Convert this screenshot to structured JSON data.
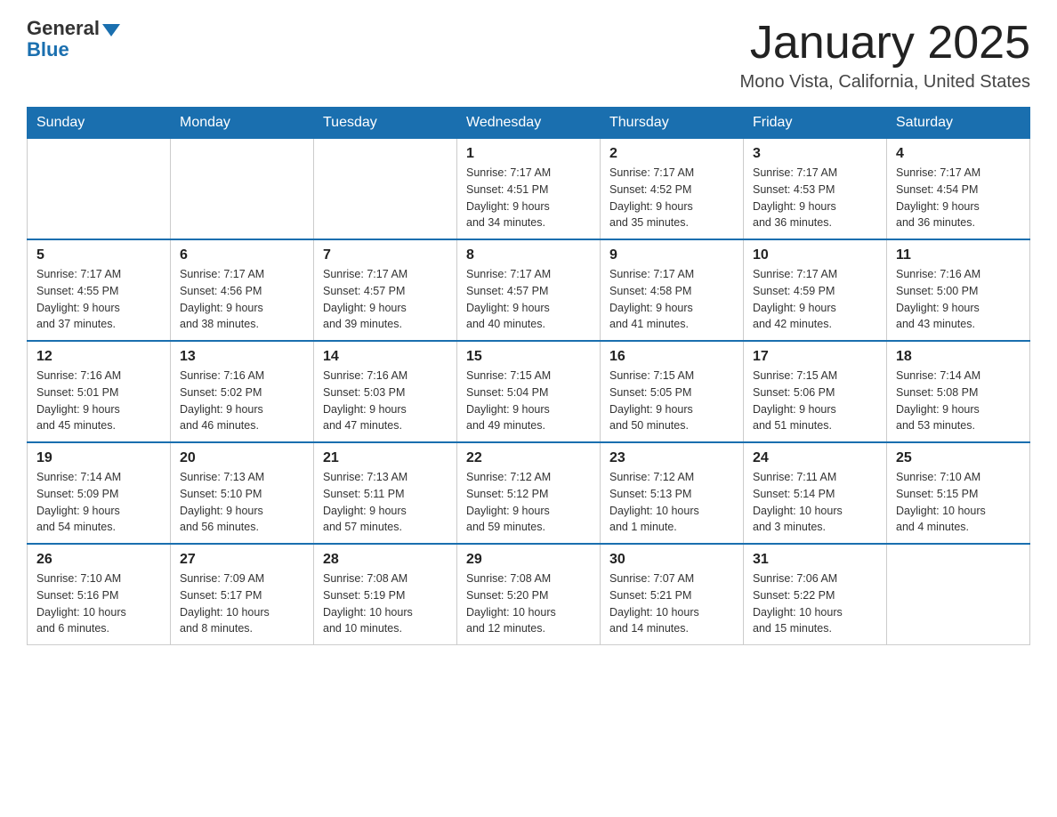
{
  "header": {
    "logo_line1": "General",
    "logo_line2": "Blue",
    "title": "January 2025",
    "subtitle": "Mono Vista, California, United States"
  },
  "weekdays": [
    "Sunday",
    "Monday",
    "Tuesday",
    "Wednesday",
    "Thursday",
    "Friday",
    "Saturday"
  ],
  "weeks": [
    [
      {
        "day": "",
        "info": ""
      },
      {
        "day": "",
        "info": ""
      },
      {
        "day": "",
        "info": ""
      },
      {
        "day": "1",
        "info": "Sunrise: 7:17 AM\nSunset: 4:51 PM\nDaylight: 9 hours\nand 34 minutes."
      },
      {
        "day": "2",
        "info": "Sunrise: 7:17 AM\nSunset: 4:52 PM\nDaylight: 9 hours\nand 35 minutes."
      },
      {
        "day": "3",
        "info": "Sunrise: 7:17 AM\nSunset: 4:53 PM\nDaylight: 9 hours\nand 36 minutes."
      },
      {
        "day": "4",
        "info": "Sunrise: 7:17 AM\nSunset: 4:54 PM\nDaylight: 9 hours\nand 36 minutes."
      }
    ],
    [
      {
        "day": "5",
        "info": "Sunrise: 7:17 AM\nSunset: 4:55 PM\nDaylight: 9 hours\nand 37 minutes."
      },
      {
        "day": "6",
        "info": "Sunrise: 7:17 AM\nSunset: 4:56 PM\nDaylight: 9 hours\nand 38 minutes."
      },
      {
        "day": "7",
        "info": "Sunrise: 7:17 AM\nSunset: 4:57 PM\nDaylight: 9 hours\nand 39 minutes."
      },
      {
        "day": "8",
        "info": "Sunrise: 7:17 AM\nSunset: 4:57 PM\nDaylight: 9 hours\nand 40 minutes."
      },
      {
        "day": "9",
        "info": "Sunrise: 7:17 AM\nSunset: 4:58 PM\nDaylight: 9 hours\nand 41 minutes."
      },
      {
        "day": "10",
        "info": "Sunrise: 7:17 AM\nSunset: 4:59 PM\nDaylight: 9 hours\nand 42 minutes."
      },
      {
        "day": "11",
        "info": "Sunrise: 7:16 AM\nSunset: 5:00 PM\nDaylight: 9 hours\nand 43 minutes."
      }
    ],
    [
      {
        "day": "12",
        "info": "Sunrise: 7:16 AM\nSunset: 5:01 PM\nDaylight: 9 hours\nand 45 minutes."
      },
      {
        "day": "13",
        "info": "Sunrise: 7:16 AM\nSunset: 5:02 PM\nDaylight: 9 hours\nand 46 minutes."
      },
      {
        "day": "14",
        "info": "Sunrise: 7:16 AM\nSunset: 5:03 PM\nDaylight: 9 hours\nand 47 minutes."
      },
      {
        "day": "15",
        "info": "Sunrise: 7:15 AM\nSunset: 5:04 PM\nDaylight: 9 hours\nand 49 minutes."
      },
      {
        "day": "16",
        "info": "Sunrise: 7:15 AM\nSunset: 5:05 PM\nDaylight: 9 hours\nand 50 minutes."
      },
      {
        "day": "17",
        "info": "Sunrise: 7:15 AM\nSunset: 5:06 PM\nDaylight: 9 hours\nand 51 minutes."
      },
      {
        "day": "18",
        "info": "Sunrise: 7:14 AM\nSunset: 5:08 PM\nDaylight: 9 hours\nand 53 minutes."
      }
    ],
    [
      {
        "day": "19",
        "info": "Sunrise: 7:14 AM\nSunset: 5:09 PM\nDaylight: 9 hours\nand 54 minutes."
      },
      {
        "day": "20",
        "info": "Sunrise: 7:13 AM\nSunset: 5:10 PM\nDaylight: 9 hours\nand 56 minutes."
      },
      {
        "day": "21",
        "info": "Sunrise: 7:13 AM\nSunset: 5:11 PM\nDaylight: 9 hours\nand 57 minutes."
      },
      {
        "day": "22",
        "info": "Sunrise: 7:12 AM\nSunset: 5:12 PM\nDaylight: 9 hours\nand 59 minutes."
      },
      {
        "day": "23",
        "info": "Sunrise: 7:12 AM\nSunset: 5:13 PM\nDaylight: 10 hours\nand 1 minute."
      },
      {
        "day": "24",
        "info": "Sunrise: 7:11 AM\nSunset: 5:14 PM\nDaylight: 10 hours\nand 3 minutes."
      },
      {
        "day": "25",
        "info": "Sunrise: 7:10 AM\nSunset: 5:15 PM\nDaylight: 10 hours\nand 4 minutes."
      }
    ],
    [
      {
        "day": "26",
        "info": "Sunrise: 7:10 AM\nSunset: 5:16 PM\nDaylight: 10 hours\nand 6 minutes."
      },
      {
        "day": "27",
        "info": "Sunrise: 7:09 AM\nSunset: 5:17 PM\nDaylight: 10 hours\nand 8 minutes."
      },
      {
        "day": "28",
        "info": "Sunrise: 7:08 AM\nSunset: 5:19 PM\nDaylight: 10 hours\nand 10 minutes."
      },
      {
        "day": "29",
        "info": "Sunrise: 7:08 AM\nSunset: 5:20 PM\nDaylight: 10 hours\nand 12 minutes."
      },
      {
        "day": "30",
        "info": "Sunrise: 7:07 AM\nSunset: 5:21 PM\nDaylight: 10 hours\nand 14 minutes."
      },
      {
        "day": "31",
        "info": "Sunrise: 7:06 AM\nSunset: 5:22 PM\nDaylight: 10 hours\nand 15 minutes."
      },
      {
        "day": "",
        "info": ""
      }
    ]
  ]
}
